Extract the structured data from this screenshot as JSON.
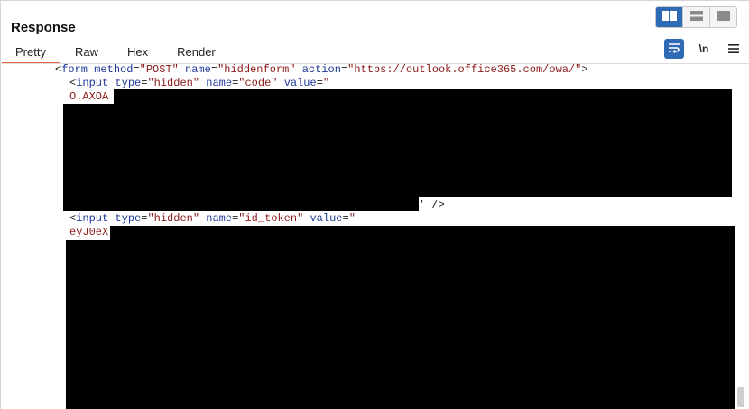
{
  "panel": {
    "title": "Response"
  },
  "tabs": [
    {
      "label": "Pretty",
      "active": true
    },
    {
      "label": "Raw",
      "active": false
    },
    {
      "label": "Hex",
      "active": false
    },
    {
      "label": "Render",
      "active": false
    }
  ],
  "tools": {
    "newline_label": "\\n"
  },
  "icons": {
    "layout_split": "columns-icon",
    "layout_rows": "rows-icon",
    "layout_single": "single-pane-icon",
    "wrap": "wrap-lines-icon",
    "menu": "hamburger-menu-icon"
  },
  "colors": {
    "accent": "#2f6bb4",
    "active_tab_underline": "#e8663d",
    "tag": "#1f3a99",
    "string": "#8a1a1a"
  },
  "code": {
    "line1": {
      "open": "<",
      "tag": "form",
      "a1": "method",
      "v1": "\"POST\"",
      "a2": "name",
      "v2": "\"hiddenform\"",
      "a3": "action",
      "v3": "\"https://outlook.office365.com/owa/\"",
      "close": ">"
    },
    "line2": {
      "open": "<",
      "tag": "input",
      "a1": "type",
      "v1": "\"hidden\"",
      "a2": "name",
      "v2": "\"code\"",
      "a3": "value",
      "v3": "\""
    },
    "line3": "O.AXOA",
    "line4": "' />",
    "line5": {
      "open": "<",
      "tag": "input",
      "a1": "type",
      "v1": "\"hidden\"",
      "a2": "name",
      "v2": "\"id_token\"",
      "a3": "value",
      "v3": "\""
    },
    "line6": "eyJ0eX"
  }
}
